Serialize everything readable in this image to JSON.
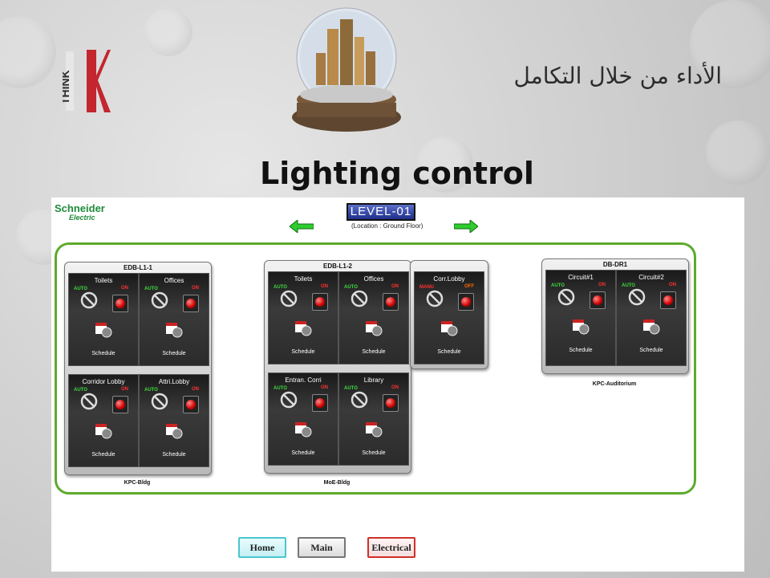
{
  "header": {
    "logo_text": "THINK",
    "tagline": "الأداء من خلال التكامل",
    "title": "Lighting control"
  },
  "panel": {
    "brand_line1": "Schneider",
    "brand_line2": "Electric",
    "level": "LEVEL-01",
    "location": "(Location :  Ground Floor)",
    "auto_label": "AUTO",
    "manu_label": "MANU",
    "on_label": "ON",
    "off_label": "OFF",
    "schedule_label": "Schedule",
    "boards": {
      "edb1": {
        "title": "EDB-L1-1",
        "cells": [
          "Toilets",
          "Offices",
          "Corridor Lobby",
          "Attri.Lobby"
        ],
        "building": "KPC-Bldg"
      },
      "edb2": {
        "title": "EDB-L1-2",
        "cells": [
          "Toilets",
          "Offices",
          "Entran. Corri",
          "Library"
        ],
        "extra": "Corr.Lobby",
        "building": "MoE-Bldg"
      },
      "dr1": {
        "title": "DB-DR1",
        "cells": [
          "Circuit#1",
          "Circuit#2"
        ],
        "building": "KPC-Auditorium"
      }
    },
    "nav": {
      "home": "Home",
      "main": "Main",
      "electrical": "Electrical"
    }
  },
  "colors": {
    "brand_green": "#1e8b3a",
    "frame_green": "#5cab2c",
    "on_red": "#ff3030",
    "auto_green": "#3ddc3d"
  }
}
